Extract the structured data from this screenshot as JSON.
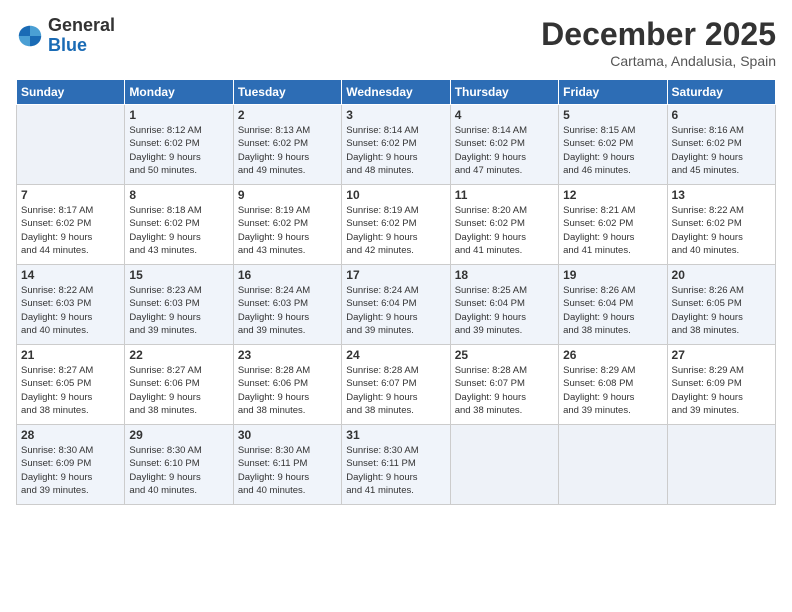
{
  "logo": {
    "general": "General",
    "blue": "Blue"
  },
  "header": {
    "month": "December 2025",
    "location": "Cartama, Andalusia, Spain"
  },
  "weekdays": [
    "Sunday",
    "Monday",
    "Tuesday",
    "Wednesday",
    "Thursday",
    "Friday",
    "Saturday"
  ],
  "weeks": [
    [
      {
        "day": "",
        "info": ""
      },
      {
        "day": "1",
        "info": "Sunrise: 8:12 AM\nSunset: 6:02 PM\nDaylight: 9 hours\nand 50 minutes."
      },
      {
        "day": "2",
        "info": "Sunrise: 8:13 AM\nSunset: 6:02 PM\nDaylight: 9 hours\nand 49 minutes."
      },
      {
        "day": "3",
        "info": "Sunrise: 8:14 AM\nSunset: 6:02 PM\nDaylight: 9 hours\nand 48 minutes."
      },
      {
        "day": "4",
        "info": "Sunrise: 8:14 AM\nSunset: 6:02 PM\nDaylight: 9 hours\nand 47 minutes."
      },
      {
        "day": "5",
        "info": "Sunrise: 8:15 AM\nSunset: 6:02 PM\nDaylight: 9 hours\nand 46 minutes."
      },
      {
        "day": "6",
        "info": "Sunrise: 8:16 AM\nSunset: 6:02 PM\nDaylight: 9 hours\nand 45 minutes."
      }
    ],
    [
      {
        "day": "7",
        "info": "Sunrise: 8:17 AM\nSunset: 6:02 PM\nDaylight: 9 hours\nand 44 minutes."
      },
      {
        "day": "8",
        "info": "Sunrise: 8:18 AM\nSunset: 6:02 PM\nDaylight: 9 hours\nand 43 minutes."
      },
      {
        "day": "9",
        "info": "Sunrise: 8:19 AM\nSunset: 6:02 PM\nDaylight: 9 hours\nand 43 minutes."
      },
      {
        "day": "10",
        "info": "Sunrise: 8:19 AM\nSunset: 6:02 PM\nDaylight: 9 hours\nand 42 minutes."
      },
      {
        "day": "11",
        "info": "Sunrise: 8:20 AM\nSunset: 6:02 PM\nDaylight: 9 hours\nand 41 minutes."
      },
      {
        "day": "12",
        "info": "Sunrise: 8:21 AM\nSunset: 6:02 PM\nDaylight: 9 hours\nand 41 minutes."
      },
      {
        "day": "13",
        "info": "Sunrise: 8:22 AM\nSunset: 6:02 PM\nDaylight: 9 hours\nand 40 minutes."
      }
    ],
    [
      {
        "day": "14",
        "info": "Sunrise: 8:22 AM\nSunset: 6:03 PM\nDaylight: 9 hours\nand 40 minutes."
      },
      {
        "day": "15",
        "info": "Sunrise: 8:23 AM\nSunset: 6:03 PM\nDaylight: 9 hours\nand 39 minutes."
      },
      {
        "day": "16",
        "info": "Sunrise: 8:24 AM\nSunset: 6:03 PM\nDaylight: 9 hours\nand 39 minutes."
      },
      {
        "day": "17",
        "info": "Sunrise: 8:24 AM\nSunset: 6:04 PM\nDaylight: 9 hours\nand 39 minutes."
      },
      {
        "day": "18",
        "info": "Sunrise: 8:25 AM\nSunset: 6:04 PM\nDaylight: 9 hours\nand 39 minutes."
      },
      {
        "day": "19",
        "info": "Sunrise: 8:26 AM\nSunset: 6:04 PM\nDaylight: 9 hours\nand 38 minutes."
      },
      {
        "day": "20",
        "info": "Sunrise: 8:26 AM\nSunset: 6:05 PM\nDaylight: 9 hours\nand 38 minutes."
      }
    ],
    [
      {
        "day": "21",
        "info": "Sunrise: 8:27 AM\nSunset: 6:05 PM\nDaylight: 9 hours\nand 38 minutes."
      },
      {
        "day": "22",
        "info": "Sunrise: 8:27 AM\nSunset: 6:06 PM\nDaylight: 9 hours\nand 38 minutes."
      },
      {
        "day": "23",
        "info": "Sunrise: 8:28 AM\nSunset: 6:06 PM\nDaylight: 9 hours\nand 38 minutes."
      },
      {
        "day": "24",
        "info": "Sunrise: 8:28 AM\nSunset: 6:07 PM\nDaylight: 9 hours\nand 38 minutes."
      },
      {
        "day": "25",
        "info": "Sunrise: 8:28 AM\nSunset: 6:07 PM\nDaylight: 9 hours\nand 38 minutes."
      },
      {
        "day": "26",
        "info": "Sunrise: 8:29 AM\nSunset: 6:08 PM\nDaylight: 9 hours\nand 39 minutes."
      },
      {
        "day": "27",
        "info": "Sunrise: 8:29 AM\nSunset: 6:09 PM\nDaylight: 9 hours\nand 39 minutes."
      }
    ],
    [
      {
        "day": "28",
        "info": "Sunrise: 8:30 AM\nSunset: 6:09 PM\nDaylight: 9 hours\nand 39 minutes."
      },
      {
        "day": "29",
        "info": "Sunrise: 8:30 AM\nSunset: 6:10 PM\nDaylight: 9 hours\nand 40 minutes."
      },
      {
        "day": "30",
        "info": "Sunrise: 8:30 AM\nSunset: 6:11 PM\nDaylight: 9 hours\nand 40 minutes."
      },
      {
        "day": "31",
        "info": "Sunrise: 8:30 AM\nSunset: 6:11 PM\nDaylight: 9 hours\nand 41 minutes."
      },
      {
        "day": "",
        "info": ""
      },
      {
        "day": "",
        "info": ""
      },
      {
        "day": "",
        "info": ""
      }
    ]
  ]
}
